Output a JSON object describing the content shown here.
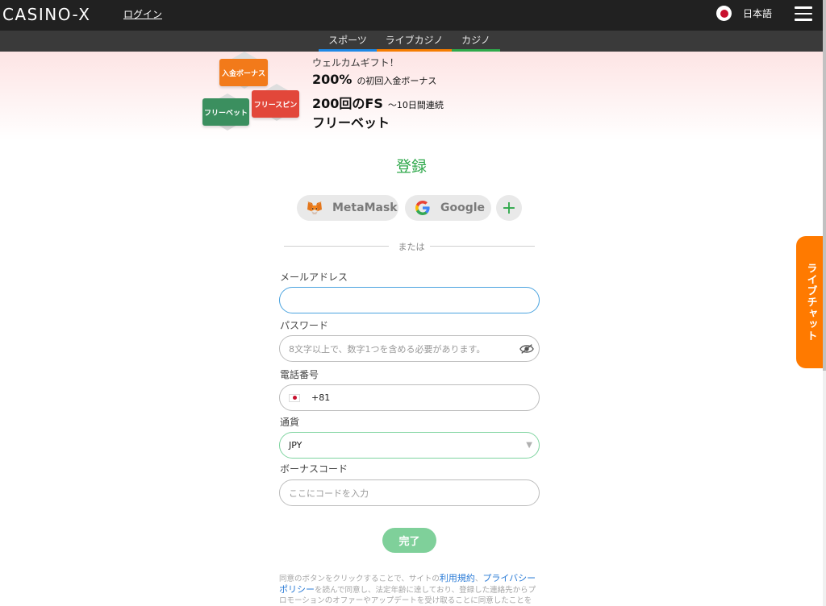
{
  "header": {
    "logo": "CASINO-X",
    "login": "ログイン",
    "language": "日本語"
  },
  "nav": {
    "tabs": [
      {
        "label": "スポーツ",
        "color": "#1e88e5"
      },
      {
        "label": "ライブカジノ",
        "color": "#f57c00"
      },
      {
        "label": "カジノ",
        "color": "#2ea84a"
      }
    ]
  },
  "banner": {
    "badges": [
      {
        "label": "入金ボーナス",
        "color": "#f27a1a"
      },
      {
        "label": "フリーベット",
        "color": "#3b8f5f"
      },
      {
        "label": "フリースピン",
        "color": "#e2473a"
      }
    ],
    "welcome": "ウェルカムギフト！",
    "bonus_amount": "200%",
    "bonus_desc": "の初回入金ボーナス",
    "fs_amount": "200回のFS",
    "fs_desc": "〜10日間連続",
    "freebet": "フリーベット"
  },
  "form": {
    "title": "登録",
    "social": {
      "metamask": "MetaMask",
      "google": "Google",
      "more": "+"
    },
    "or": "または",
    "email_label": "メールアドレス",
    "email_value": "",
    "password_label": "パスワード",
    "password_placeholder": "8文字以上で、数字1つを含める必要があります。",
    "phone_label": "電話番号",
    "phone_code": "+81",
    "currency_label": "通貨",
    "currency_value": "JPY",
    "bonus_label": "ボーナスコード",
    "bonus_placeholder": "ここにコードを入力",
    "submit": "完了"
  },
  "terms": {
    "part1": "同意のボタンをクリックすることで、サイトの",
    "link1": "利用規約",
    "sep": "、",
    "link2": "プライバシーポリシー",
    "part2": "を読んで同意し、法定年齢に達しており、登録した連絡先からプロモーションのオファーやアップデートを受け取ることに同意したことを確認します。"
  },
  "livechat": "ライブチャット",
  "colors": {
    "accent_green": "#2ea84a",
    "focus_blue": "#4aa3df",
    "livechat_orange": "#ff7a00"
  }
}
